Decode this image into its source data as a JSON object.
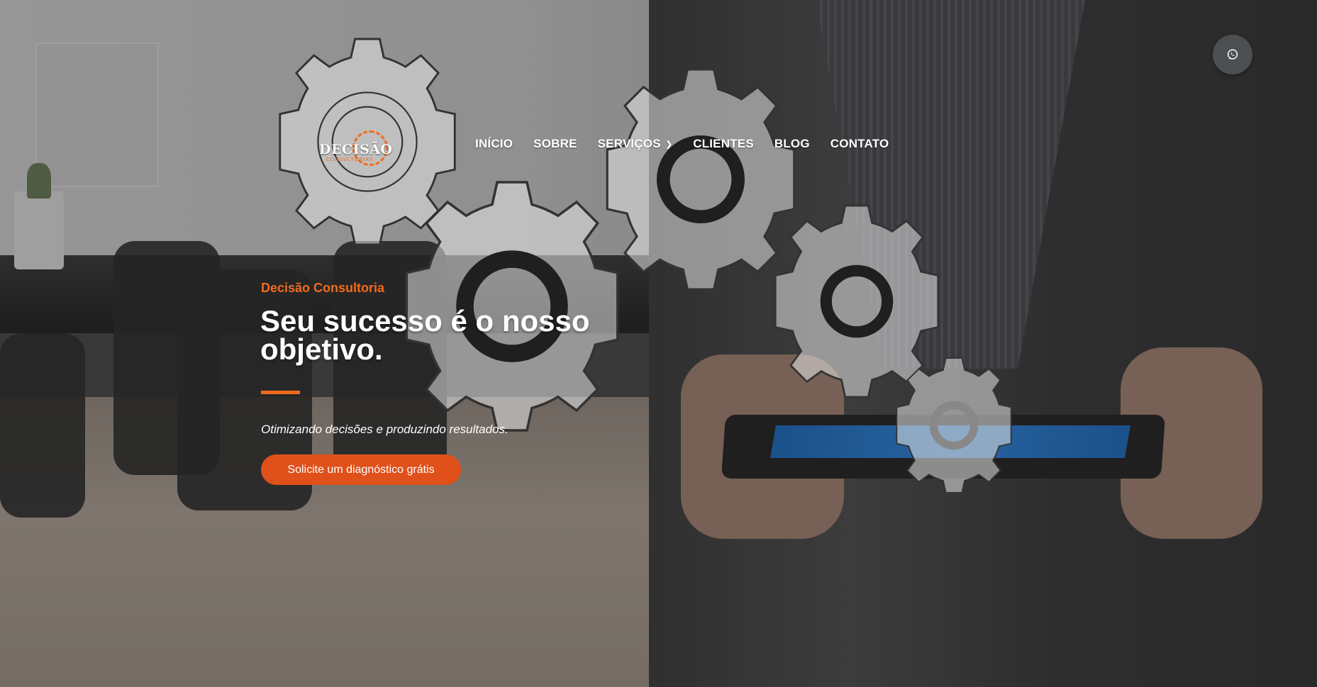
{
  "logo": {
    "name": "DECISÃO",
    "subtitle": "CONSULTORIAS",
    "icon": "gear-logo-icon"
  },
  "nav": {
    "items": [
      {
        "label": "INÍCIO"
      },
      {
        "label": "SOBRE"
      },
      {
        "label": "SERVIÇOS",
        "dropdown": true
      },
      {
        "label": "CLIENTES"
      },
      {
        "label": "BLOG"
      },
      {
        "label": "CONTATO"
      }
    ]
  },
  "whatsapp": {
    "icon": "whatsapp-icon"
  },
  "hero": {
    "eyebrow": "Decisão Consultoria",
    "headline": "Seu sucesso é o nosso objetivo.",
    "tagline": "Otimizando decisões e produzindo resultados.",
    "cta_label": "Solicite um diagnóstico grátis"
  },
  "colors": {
    "accent": "#f26b1d",
    "cta": "#e0501a",
    "text": "#ffffff"
  }
}
